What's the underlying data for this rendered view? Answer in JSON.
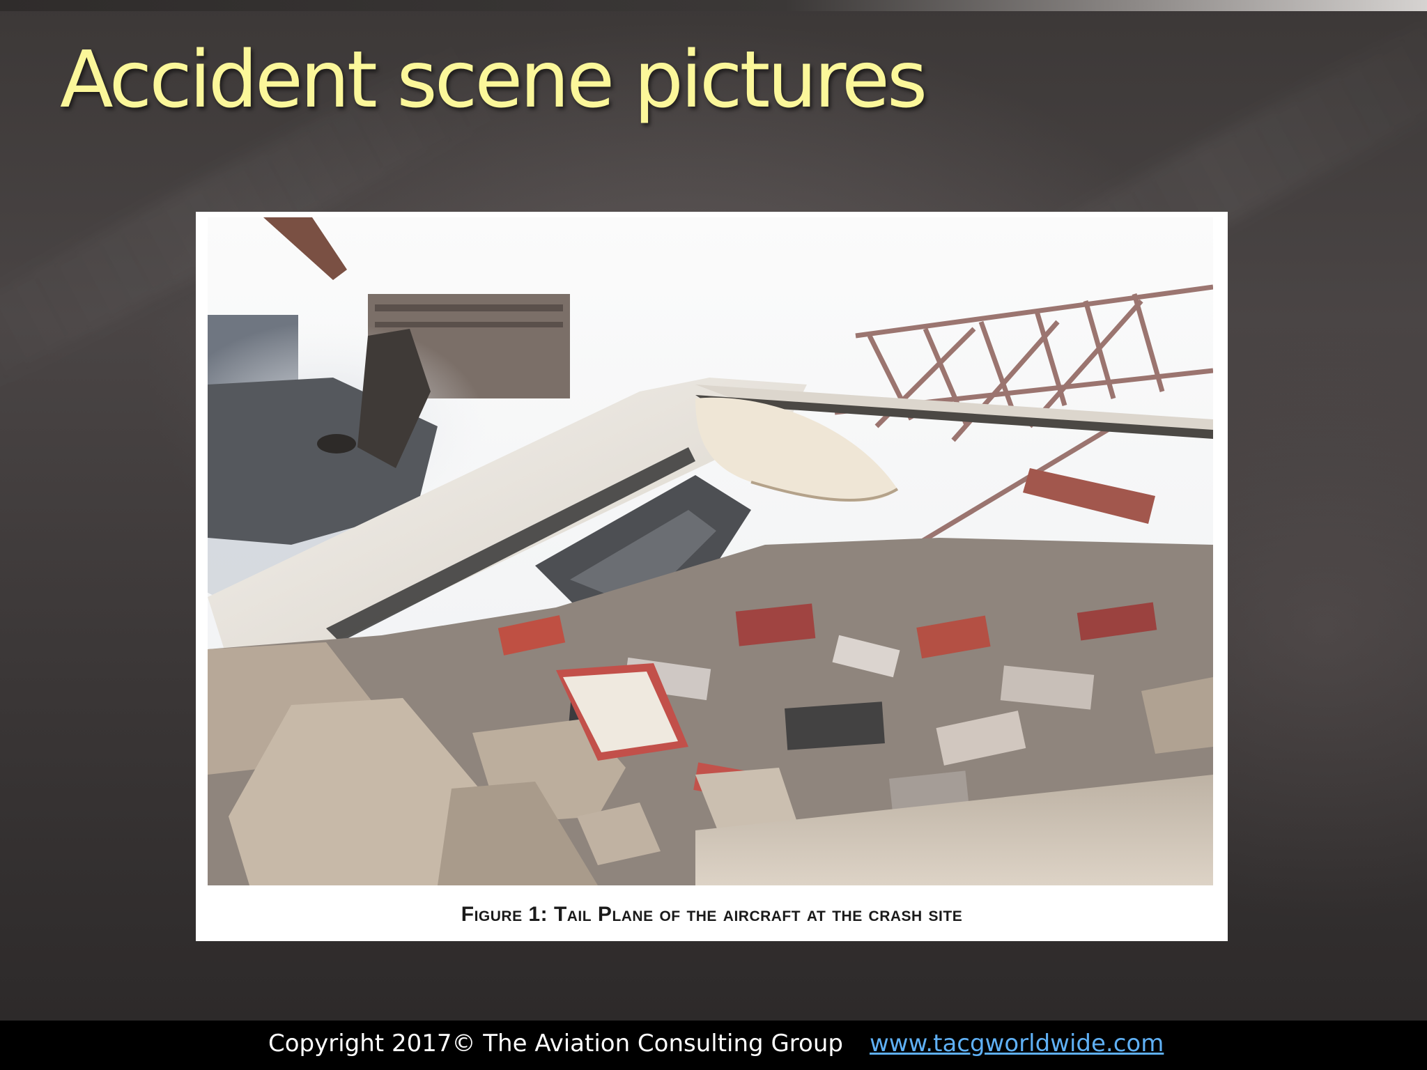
{
  "slide": {
    "title": "Accident scene pictures"
  },
  "figure": {
    "caption": "Figure 1: Tail Plane of the aircraft at the crash site",
    "image_description": "aircraft-wreckage-photo"
  },
  "footer": {
    "copyright": "Copyright 2017© The Aviation Consulting Group",
    "link": "www.tacgworldwide.com"
  },
  "colors": {
    "title": "#fbf79a",
    "link": "#5fb0f5",
    "footer_bg": "#000000"
  }
}
